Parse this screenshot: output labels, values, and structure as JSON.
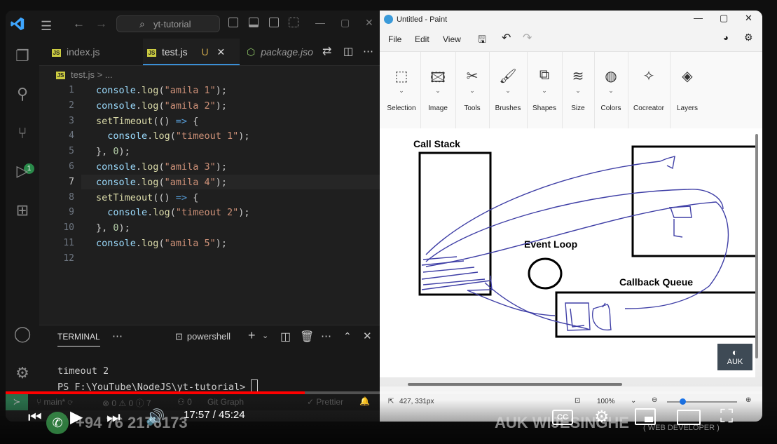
{
  "vscode": {
    "search_text": "yt-tutorial",
    "tabs": [
      {
        "label": "index.js"
      },
      {
        "label": "test.js",
        "status": "U"
      },
      {
        "label": "package.jso"
      }
    ],
    "breadcrumb_file": "test.js",
    "breadcrumb_more": "> ...",
    "scm_badge": "1",
    "line_numbers": [
      "1",
      "2",
      "3",
      "4",
      "5",
      "6",
      "7",
      "8",
      "9",
      "10",
      "11",
      "12"
    ],
    "code_lines": [
      "console.log(\"amila 1\");",
      "console.log(\"amila 2\");",
      "setTimeout(() => {",
      "  console.log(\"timeout 1\");",
      "}, 0);",
      "console.log(\"amila 3\");",
      "console.log(\"amila 4\");",
      "setTimeout(() => {",
      "  console.log(\"timeout 2\");",
      "}, 0);",
      "console.log(\"amila 5\");",
      ""
    ],
    "terminal": {
      "tab_label": "TERMINAL",
      "shell_label": "powershell",
      "output_line": "timeout 2",
      "prompt": "PS F:\\YouTube\\NodeJS\\yt-tutorial>"
    },
    "statusbar": {
      "branch": "main*",
      "problems": "⊗ 0 ⚠ 0 ⓘ 7",
      "ports": "0",
      "git_graph": "Git Graph",
      "prettier": "✓ Prettier"
    }
  },
  "paint": {
    "title": "Untitled - Paint",
    "menu": [
      "File",
      "Edit",
      "View"
    ],
    "tools": [
      {
        "label": "Selection",
        "icon": "selection-icon"
      },
      {
        "label": "Image",
        "icon": "image-icon"
      },
      {
        "label": "Tools",
        "icon": "tools-icon"
      },
      {
        "label": "Brushes",
        "icon": "brushes-icon"
      },
      {
        "label": "Shapes",
        "icon": "shapes-icon"
      },
      {
        "label": "Size",
        "icon": "size-icon"
      },
      {
        "label": "Colors",
        "icon": "colors-icon"
      },
      {
        "label": "Cocreator",
        "icon": "cocreator-icon"
      },
      {
        "label": "Layers",
        "icon": "layers-icon"
      }
    ],
    "canvas_labels": {
      "call_stack": "Call Stack",
      "event_loop": "Event Loop",
      "callback_queue": "Callback Queue"
    },
    "cursor_position": "427, 331px",
    "zoom": "100%",
    "watermark_logo": "AUK"
  },
  "youtube": {
    "time": "17:57 / 45:24",
    "progress": 0.395,
    "phone_watermark": "+94 76 2176173",
    "brand_watermark": "AUK WIJESINGHE",
    "brand_sub": "( WEB DEVELOPER )",
    "cc_label": "CC"
  }
}
